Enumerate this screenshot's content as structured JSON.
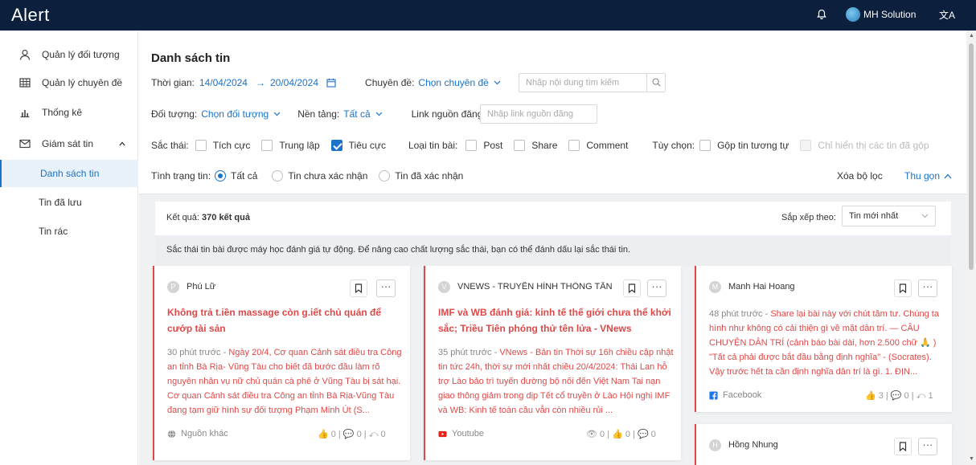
{
  "header": {
    "logo": "Alert",
    "user_name": "MH Solution",
    "lang_glyph": "文A"
  },
  "sidebar": {
    "items": [
      {
        "label": "Quản lý đối tượng",
        "icon": "user-icon"
      },
      {
        "label": "Quản lý chuyên đề",
        "icon": "table-icon"
      },
      {
        "label": "Thống kê",
        "icon": "bar-chart-icon"
      },
      {
        "label": "Giám sát tin",
        "icon": "mail-icon"
      }
    ],
    "sub_items": [
      {
        "label": "Danh sách tin",
        "active": true
      },
      {
        "label": "Tin đã lưu",
        "active": false
      },
      {
        "label": "Tin rác",
        "active": false
      }
    ]
  },
  "filter": {
    "page_title": "Danh sách tin",
    "time_label": "Thời gian:",
    "date_from": "14/04/2024",
    "date_arrow": "→",
    "date_to": "20/04/2024",
    "topic_label": "Chuyên đề:",
    "topic_value": "Chọn chuyên đề",
    "search_placeholder": "Nhập nội dung tìm kiếm",
    "object_label": "Đối tượng:",
    "object_value": "Chọn đối tượng",
    "platform_label": "Nền tảng:",
    "platform_value": "Tất cả",
    "link_label": "Link nguồn đăng:",
    "link_placeholder": "Nhập link nguồn đăng",
    "sentiment_label": "Sắc thái:",
    "sentiment_options": [
      {
        "label": "Tích cực",
        "checked": false
      },
      {
        "label": "Trung lập",
        "checked": false
      },
      {
        "label": "Tiêu cực",
        "checked": true
      }
    ],
    "post_type_label": "Loại tin bài:",
    "post_types": [
      {
        "label": "Post",
        "checked": false
      },
      {
        "label": "Share",
        "checked": false
      },
      {
        "label": "Comment",
        "checked": false
      }
    ],
    "option_label": "Tùy chọn:",
    "option_group": "Gộp tin tương tự",
    "option_only_grouped": "Chỉ hiển thị các tin đã gộp",
    "status_label": "Tình trạng tin:",
    "status_options": [
      {
        "label": "Tất cả",
        "selected": true
      },
      {
        "label": "Tin chưa xác nhận",
        "selected": false
      },
      {
        "label": "Tin đã xác nhận",
        "selected": false
      }
    ],
    "clear_label": "Xóa bộ lọc",
    "collapse_label": "Thu gọn"
  },
  "results": {
    "prefix": "Kết quả:",
    "count_text": "370 kết quả",
    "sort_label": "Sắp xếp theo:",
    "sort_value": "Tin mới nhất",
    "notice": "Sắc thái tin bài được máy học đánh giá tự động. Để nâng cao chất lượng sắc thái, bạn có thể đánh dấu lại sắc thái tin."
  },
  "cards": [
    {
      "avatar_letter": "P",
      "author": "Phú Lữ",
      "title": "Không trả t.iền massage còn g.iết chủ quán để cướp tài sản",
      "time": "30 phút trước -",
      "snippet": "Ngày 20/4, Cơ quan Cảnh sát điều tra Công an tỉnh Bà Rịa- Vũng Tàu cho biết đã bước đầu làm rõ nguyên nhân vụ nữ chủ quán cà phê ở Vũng Tàu bị sát hại. Cơ quan Cảnh sát điều tra Công an tỉnh Bà Rịa-Vũng Tàu đang tạm giữ hình sự đối tượng Phạm Minh Út (S...",
      "source": "Nguồn khác",
      "stats": "👍 0 | 💬 0 | ⤺ 0"
    },
    {
      "avatar_letter": "V",
      "author": "VNEWS - TRUYỀN HÌNH THÔNG TẤN",
      "title": "IMF và WB đánh giá: kinh tế thế giới chưa thể khởi sắc; Triều Tiên phóng thử tên lửa - VNews",
      "time": "35 phút trước -",
      "snippet": "VNews - Bản tin Thời sự 16h chiều cập nhật tin tức 24h, thời sự mới nhất chiều 20/4/2024: Thái Lan hỗ trợ Lào bảo trì tuyến đường bộ nối đến Việt Nam Tai nạn giao thông giảm trong dịp Tết cổ truyền ở Lào Hội nghị IMF và WB: Kinh tế toàn cầu vẫn còn nhiều rủi ...",
      "source": "Youtube",
      "stats": "👁 0 | 👍 0 | 💬 0"
    },
    {
      "avatar_letter": "M",
      "author": "Manh Hai Hoang",
      "title": "",
      "time": "48 phút trước -",
      "snippet": "Share lại bài này với chút tâm tư. Chúng ta hình như không có cải thiện gì về mặt dân trí. — CÂU CHUYỆN DÂN TRÍ (cảnh báo bài dài, hơn 2.500 chữ 🙏 ) \"Tất cả phải được bắt đầu bằng định nghĩa\" - (Socrates). Vậy trước hết ta cần định nghĩa dân trí là gì. 1. ĐỊN...",
      "source": "Facebook",
      "stats": "👍 3 | 💬 0 | ⤺ 1"
    },
    {
      "avatar_letter": "H",
      "author": "Hồng Nhung",
      "title": "",
      "time": "",
      "snippet": "",
      "source": "",
      "stats": ""
    }
  ],
  "colors": {
    "topbar": "#0c1f3d",
    "accent": "#1a73c9",
    "negative": "#e04848"
  }
}
